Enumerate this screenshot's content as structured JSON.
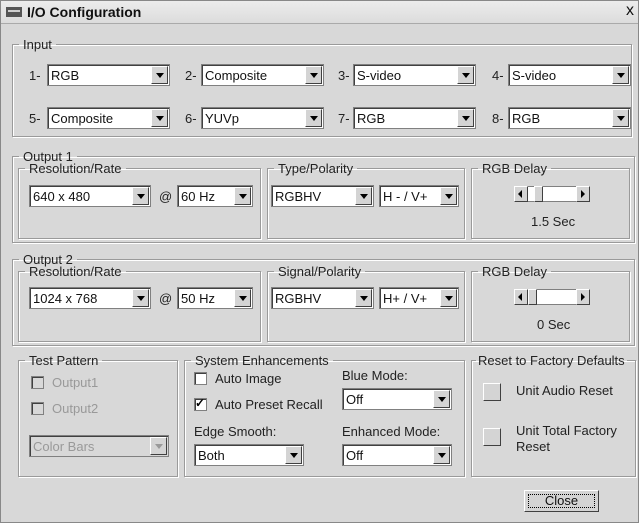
{
  "window": {
    "title": "I/O Configuration",
    "close_glyph": "x"
  },
  "input": {
    "legend": "Input",
    "slots": [
      {
        "num": "1-",
        "value": "RGB"
      },
      {
        "num": "2-",
        "value": "Composite"
      },
      {
        "num": "3-",
        "value": "S-video"
      },
      {
        "num": "4-",
        "value": "S-video"
      },
      {
        "num": "5-",
        "value": "Composite"
      },
      {
        "num": "6-",
        "value": "YUVp"
      },
      {
        "num": "7-",
        "value": "RGB"
      },
      {
        "num": "8-",
        "value": "RGB"
      }
    ]
  },
  "output1": {
    "legend": "Output 1",
    "res_legend": "Resolution/Rate",
    "resolution": "640 x 480",
    "at": "@",
    "rate": "60 Hz",
    "type_legend": "Type/Polarity",
    "type": "RGBHV",
    "polarity": "H - / V+",
    "delay_legend": "RGB Delay",
    "delay_value": "1.5 Sec",
    "delay_level": 0.15
  },
  "output2": {
    "legend": "Output 2",
    "res_legend": "Resolution/Rate",
    "resolution": "1024 x 768",
    "at": "@",
    "rate": "50 Hz",
    "signal_legend": "Signal/Polarity",
    "type": "RGBHV",
    "polarity": "H+ / V+",
    "delay_legend": "RGB Delay",
    "delay_value": "0 Sec",
    "delay_level": 0.0
  },
  "test_pattern": {
    "legend": "Test Pattern",
    "output1_label": "Output1",
    "output2_label": "Output2",
    "pattern": "Color Bars"
  },
  "system": {
    "legend": "System Enhancements",
    "auto_image_label": "Auto Image",
    "auto_preset_label": "Auto Preset Recall",
    "blue_mode_label": "Blue Mode:",
    "blue_mode": "Off",
    "edge_smooth_label": "Edge Smooth:",
    "edge_smooth": "Both",
    "enhanced_mode_label": "Enhanced Mode:",
    "enhanced_mode": "Off"
  },
  "reset": {
    "legend": "Reset to Factory Defaults",
    "audio_reset": "Unit Audio Reset",
    "total_reset_line1": "Unit Total Factory",
    "total_reset_line2": "Reset"
  },
  "footer": {
    "close_label": "Close"
  }
}
